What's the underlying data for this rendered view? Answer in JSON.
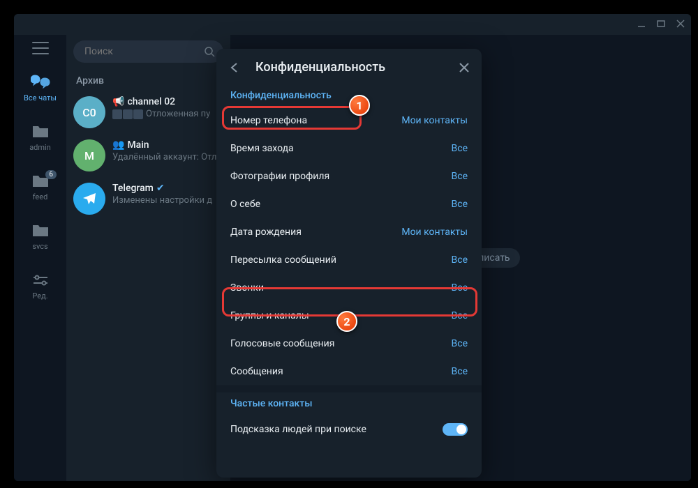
{
  "titlebar": {},
  "sidebar": {
    "folders": [
      {
        "label": "Все чаты",
        "badge": "",
        "active": true
      },
      {
        "label": "admin",
        "badge": ""
      },
      {
        "label": "feed",
        "badge": "6"
      },
      {
        "label": "svcs",
        "badge": ""
      },
      {
        "label": "Ред.",
        "badge": ""
      }
    ]
  },
  "search": {
    "placeholder": "Поиск"
  },
  "chatlist": {
    "archive_label": "Архив",
    "chats": [
      {
        "avatar_text": "C0",
        "title": "channel 02",
        "subtitle": "Отложенная пу"
      },
      {
        "avatar_text": "M",
        "title": "Main",
        "subtitle": "Удалённый аккаунт: Отл"
      },
      {
        "avatar_text": "",
        "title": "Telegram",
        "subtitle": "Изменены настройки д"
      }
    ]
  },
  "main": {
    "placeholder": "у хотели бы написать"
  },
  "modal": {
    "title": "Конфиденциальность",
    "section1_header": "Конфиденциальность",
    "rows": [
      {
        "label": "Номер телефона",
        "value": "Мои контакты"
      },
      {
        "label": "Время захода",
        "value": "Все"
      },
      {
        "label": "Фотографии профиля",
        "value": "Все"
      },
      {
        "label": "О себе",
        "value": "Все"
      },
      {
        "label": "Дата рождения",
        "value": "Мои контакты"
      },
      {
        "label": "Пересылка сообщений",
        "value": "Все"
      },
      {
        "label": "Звонки",
        "value": "Все"
      },
      {
        "label": "Группы и каналы",
        "value": "Все"
      },
      {
        "label": "Голосовые сообщения",
        "value": "Все"
      },
      {
        "label": "Сообщения",
        "value": "Все"
      }
    ],
    "section2_header": "Частые контакты",
    "toggle_label": "Подсказка людей при поиске"
  },
  "markers": {
    "m1": "1",
    "m2": "2"
  }
}
